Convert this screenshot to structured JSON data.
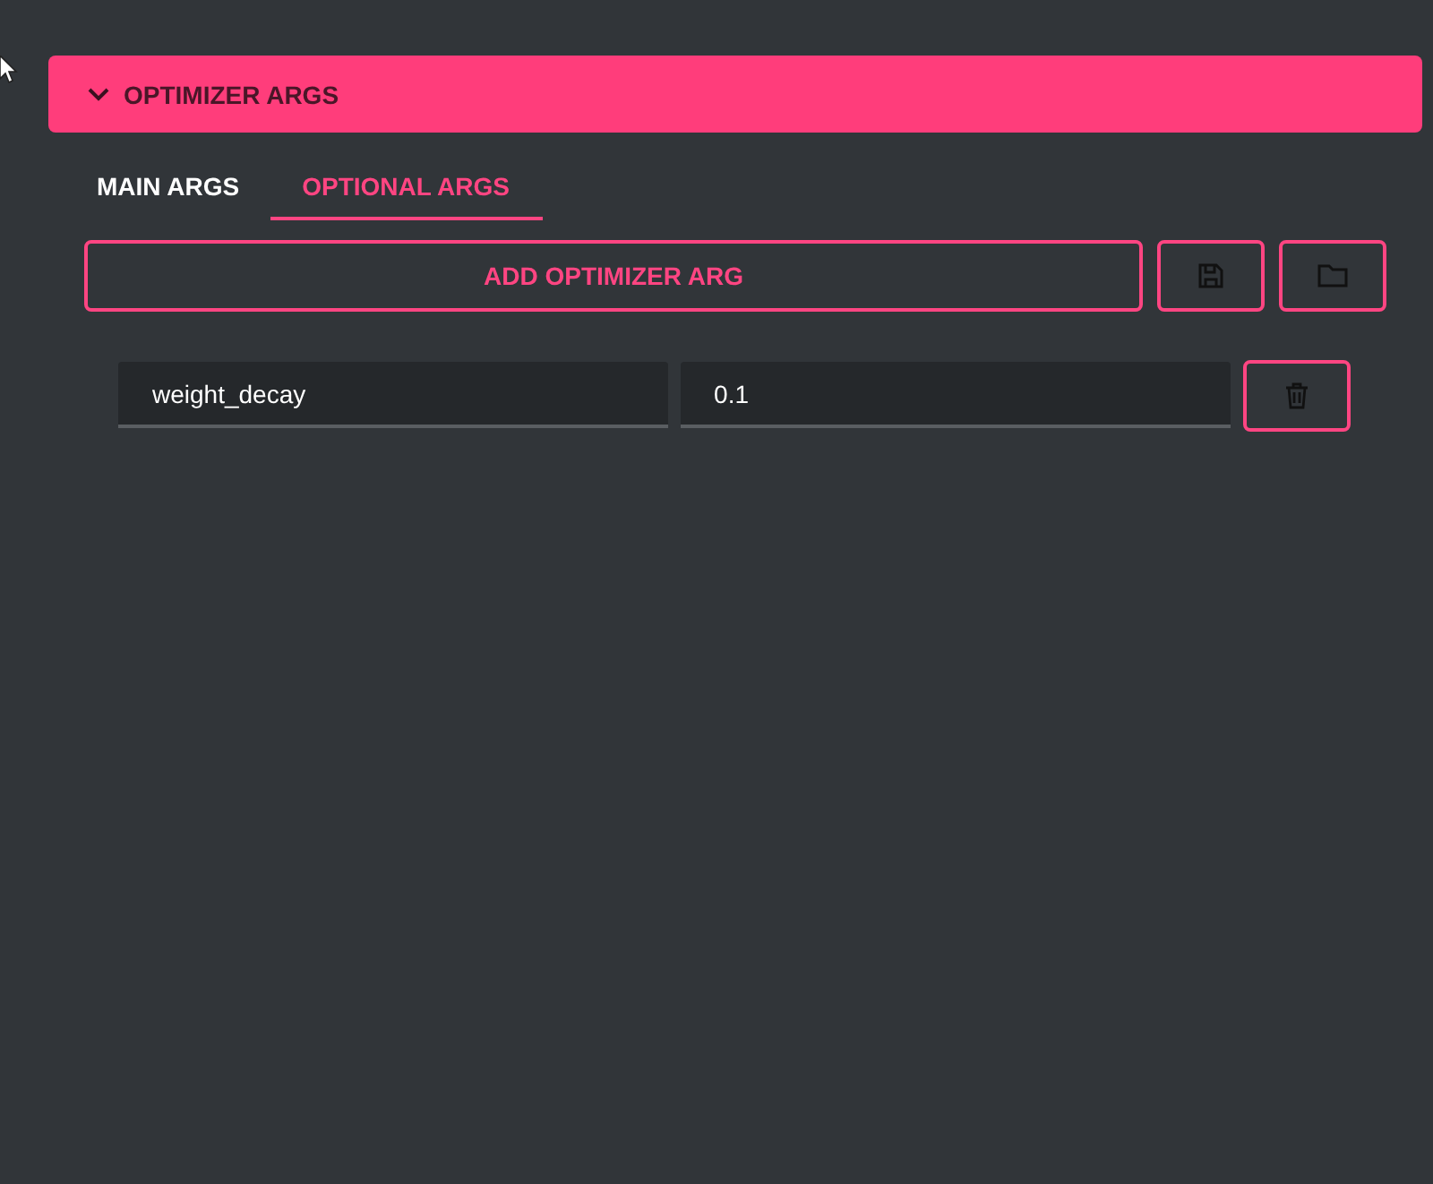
{
  "panel": {
    "title": "OPTIMIZER ARGS",
    "expanded": true
  },
  "tabs": [
    {
      "label": "MAIN ARGS",
      "selected": false
    },
    {
      "label": "OPTIONAL ARGS",
      "selected": true
    }
  ],
  "add_button": "ADD OPTIMIZER ARG",
  "args": [
    {
      "key": "weight_decay",
      "value": "0.1"
    }
  ]
}
